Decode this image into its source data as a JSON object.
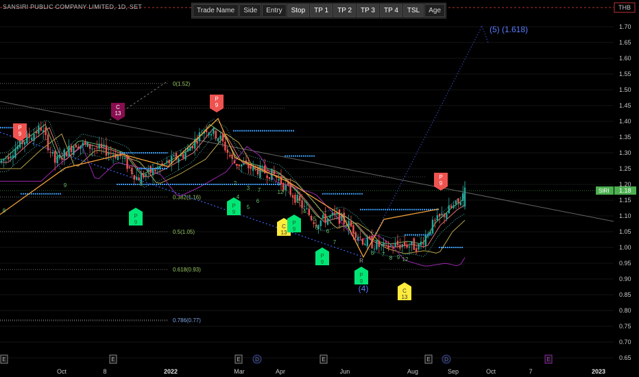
{
  "header": {
    "symbol_title": "SANSIRI PUBLIC COMPANY LIMITED, 1D, SET",
    "currency": "THB"
  },
  "toolbar": {
    "buttons": [
      {
        "label": "Trade Name",
        "active": false
      },
      {
        "label": "Side",
        "active": false
      },
      {
        "label": "Entry",
        "active": false
      },
      {
        "label": "Stop",
        "active": true
      },
      {
        "label": "TP 1",
        "active": true
      },
      {
        "label": "TP 2",
        "active": true
      },
      {
        "label": "TP 3",
        "active": true
      },
      {
        "label": "TP 4",
        "active": true
      },
      {
        "label": "TSL",
        "active": true
      },
      {
        "label": "Age",
        "active": false
      }
    ]
  },
  "chart_data": {
    "type": "candlestick",
    "symbol": "SIRI",
    "last_price": 1.18,
    "y_ticks": [
      0.65,
      0.7,
      0.75,
      0.8,
      0.85,
      0.9,
      0.95,
      1.0,
      1.05,
      1.1,
      1.15,
      1.2,
      1.25,
      1.3,
      1.35,
      1.4,
      1.45,
      1.5,
      1.55,
      1.6,
      1.65,
      1.7
    ],
    "ylim": [
      0.64,
      1.78
    ],
    "x_ticks": [
      "Oct",
      "8",
      "2022",
      "Mar",
      "Apr",
      "Jun",
      "Aug",
      "Sep",
      "Oct",
      "7",
      "2023"
    ],
    "fib_levels": [
      {
        "label": "0(1.52)",
        "value": 1.52
      },
      {
        "label": "0.382(1.16)",
        "value": 1.16
      },
      {
        "label": "0.5(1.05)",
        "value": 1.05
      },
      {
        "label": "0.618(0.93)",
        "value": 0.93
      },
      {
        "label": "0.786(0.77)",
        "value": 0.77
      }
    ],
    "wave_labels": [
      {
        "label": "(4)",
        "value": 0.88
      },
      {
        "label": "(5) (1.618)",
        "value": 1.71
      }
    ],
    "signal_markers": [
      {
        "type": "sell",
        "line1": "P",
        "line2": "9",
        "value": 1.38
      },
      {
        "type": "sell_dark",
        "line1": "C",
        "line2": "13",
        "value": 1.43
      },
      {
        "type": "sell",
        "line1": "P",
        "line2": "9",
        "value": 1.44
      },
      {
        "type": "buy",
        "line1": "P",
        "line2": "9",
        "value": 1.12
      },
      {
        "type": "buy",
        "line1": "P",
        "line2": "9",
        "value": 1.12
      },
      {
        "type": "buy_yellow",
        "line1": "C",
        "line2": "13",
        "value": 1.07
      },
      {
        "type": "buy",
        "line1": "P",
        "line2": "9",
        "value": 1.08
      },
      {
        "type": "buy",
        "line1": "P",
        "line2": "9",
        "value": 1.0
      },
      {
        "type": "buy",
        "line1": "P",
        "line2": "9",
        "value": 0.93
      },
      {
        "type": "buy_yellow",
        "line1": "C",
        "line2": "13",
        "value": 0.89
      },
      {
        "type": "sell",
        "line1": "P",
        "line2": "9",
        "value": 1.21
      }
    ],
    "event_badges": [
      "E",
      "E",
      "E",
      "D",
      "E",
      "E",
      "D",
      "E"
    ],
    "colors": {
      "up": "#26a69a",
      "down": "#ef5350",
      "wave_line": "#f4a13a",
      "projection": "#4466ff",
      "fib": "#777777",
      "tp_line": "#3d9df5",
      "price_tag": "#4caf50"
    }
  }
}
